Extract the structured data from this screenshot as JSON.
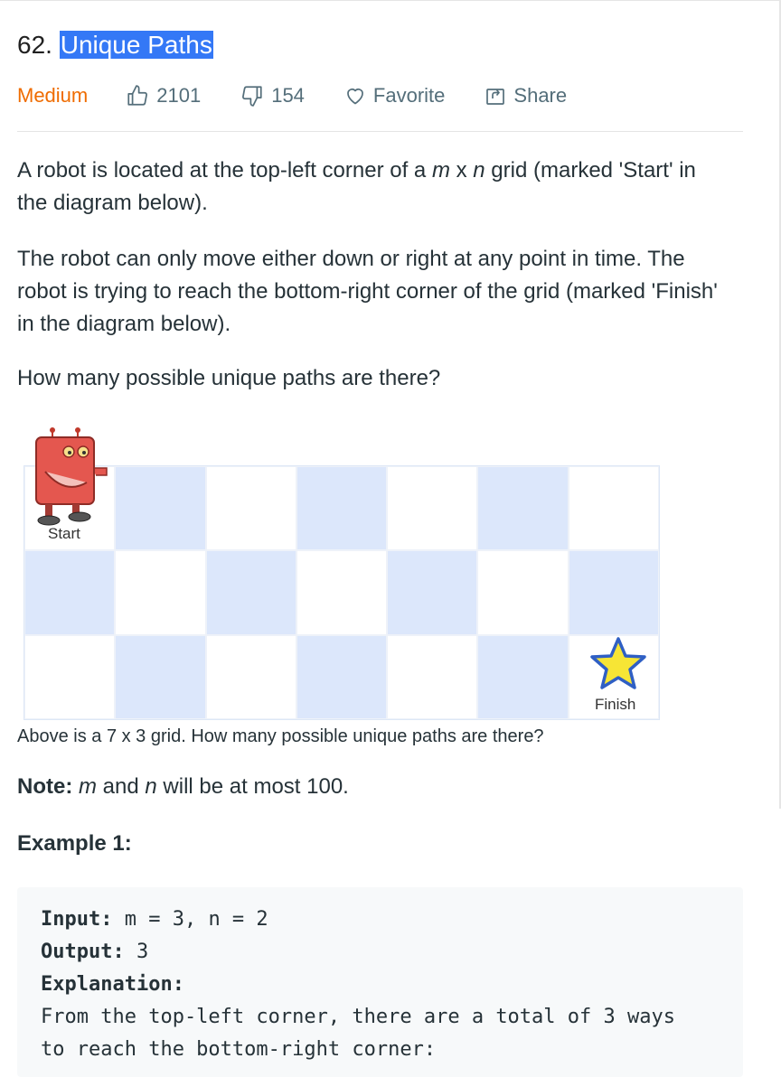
{
  "problem": {
    "number": "62.",
    "title": "Unique Paths"
  },
  "meta": {
    "difficulty": "Medium",
    "likes": "2101",
    "dislikes": "154",
    "favorite_label": "Favorite",
    "share_label": "Share",
    "difficulty_color": "#ef6c00",
    "icons": [
      "thumbs-up-icon",
      "thumbs-down-icon",
      "heart-icon",
      "share-icon"
    ]
  },
  "description": {
    "p1_a": "A robot is located at the top-left corner of a ",
    "p1_m": "m",
    "p1_x": " x ",
    "p1_n": "n",
    "p1_b": " grid (marked 'Start' in the diagram below).",
    "p2": "The robot can only move either down or right at any point in time. The robot is trying to reach the bottom-right corner of the grid (marked 'Finish' in the diagram below).",
    "p3": "How many possible unique paths are there?"
  },
  "figure": {
    "start_label": "Start",
    "finish_label": "Finish",
    "columns": 7,
    "rows": 3,
    "cell_colors": [
      "#dce7fb",
      "#ffffff"
    ]
  },
  "caption": "Above is a 7 x 3 grid. How many possible unique paths are there?",
  "note": {
    "label": "Note:",
    "m": "m",
    "and": " and ",
    "n": "n",
    "rest": " will be at most 100."
  },
  "example": {
    "title": "Example 1:",
    "input_label": "Input:",
    "input_value": " m = 3, n = 2",
    "output_label": "Output:",
    "output_value": " 3",
    "explanation_label": "Explanation:",
    "explanation_line1": "From the top-left corner, there are a total of 3 ways",
    "explanation_line2": "to reach the bottom-right corner:"
  }
}
